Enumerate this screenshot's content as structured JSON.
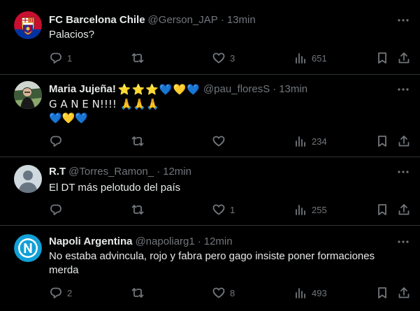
{
  "tweets": [
    {
      "name": "FC Barcelona Chile",
      "handle": "@Gerson_JAP",
      "dot": "·",
      "time": "13min",
      "emoji": "",
      "text1": "Palacios?",
      "text2": "",
      "replies": "1",
      "retweets": "",
      "likes": "3",
      "views": "651",
      "avatar": "barcelona-crest"
    },
    {
      "name": "Maria Jujeña!",
      "handle": "@pau_floresS",
      "dot": "·",
      "time": "13min",
      "emoji": "⭐⭐⭐💙💛💙",
      "text1": "G A N E N!!!! 🙏🙏🙏",
      "text2": "💙💛💙",
      "replies": "",
      "retweets": "",
      "likes": "",
      "views": "234",
      "avatar": "stadium-photo"
    },
    {
      "name": "R.T",
      "handle": "@Torres_Ramon_",
      "dot": "·",
      "time": "12min",
      "emoji": "",
      "text1": "El DT más pelotudo del país",
      "text2": "",
      "replies": "",
      "retweets": "",
      "likes": "1",
      "views": "255",
      "avatar": "default-profile"
    },
    {
      "name": "Napoli Argentina",
      "handle": "@napoliarg1",
      "dot": "·",
      "time": "12min",
      "emoji": "",
      "text1": "No estaba advincula, rojo y fabra pero gago insiste poner formaciones",
      "text2": "merda",
      "replies": "2",
      "retweets": "",
      "likes": "8",
      "views": "493",
      "avatar": "napoli-crest"
    }
  ],
  "colors": {
    "background": "#000000",
    "text": "#e7e9ea",
    "muted": "#71767b",
    "divider": "#2f3336"
  }
}
